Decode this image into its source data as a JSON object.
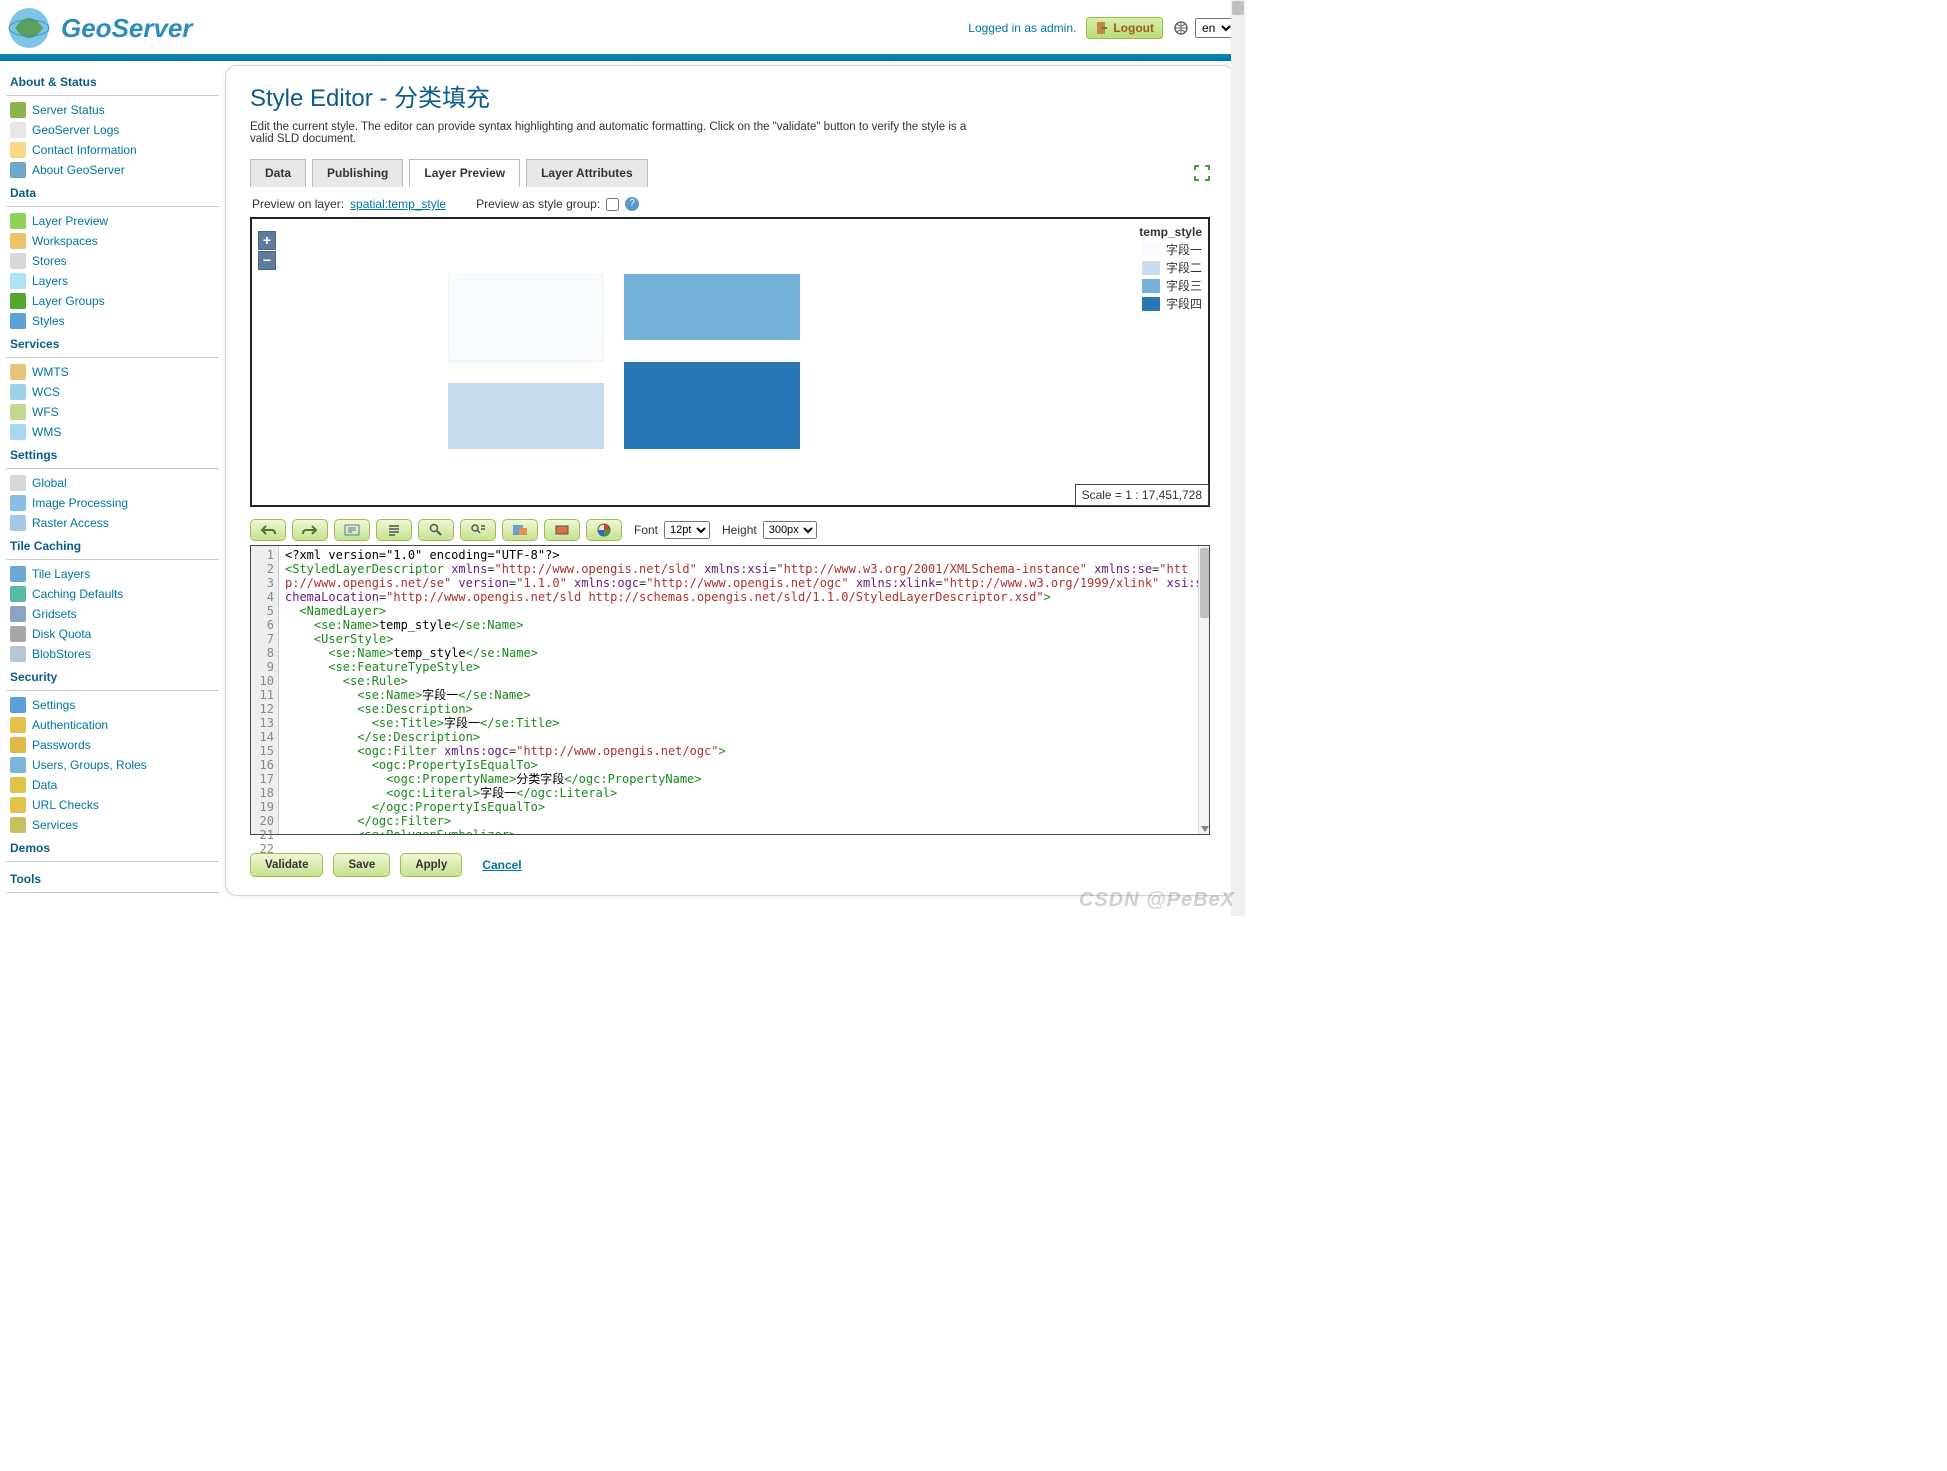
{
  "header": {
    "brand": "GeoServer",
    "loggedIn": "Logged in as admin.",
    "logoutLabel": "Logout",
    "langValue": "en"
  },
  "sidebar": {
    "sections": [
      {
        "title": "About & Status",
        "items": [
          {
            "label": "Server Status",
            "icon": "#8fb24a"
          },
          {
            "label": "GeoServer Logs",
            "icon": "#e6e6e6"
          },
          {
            "label": "Contact Information",
            "icon": "#f8d882"
          },
          {
            "label": "About GeoServer",
            "icon": "#6fa7c9"
          }
        ]
      },
      {
        "title": "Data",
        "items": [
          {
            "label": "Layer Preview",
            "icon": "#8ed25a"
          },
          {
            "label": "Workspaces",
            "icon": "#e9c46a"
          },
          {
            "label": "Stores",
            "icon": "#d8d8d8"
          },
          {
            "label": "Layers",
            "icon": "#aee2f7"
          },
          {
            "label": "Layer Groups",
            "icon": "#55a630"
          },
          {
            "label": "Styles",
            "icon": "#5da0d6"
          }
        ]
      },
      {
        "title": "Services",
        "items": [
          {
            "label": "WMTS",
            "icon": "#e6c27a"
          },
          {
            "label": "WCS",
            "icon": "#9ed0e6"
          },
          {
            "label": "WFS",
            "icon": "#c1d890"
          },
          {
            "label": "WMS",
            "icon": "#a8d8ef"
          }
        ]
      },
      {
        "title": "Settings",
        "items": [
          {
            "label": "Global",
            "icon": "#d8d8d8"
          },
          {
            "label": "Image Processing",
            "icon": "#88bde6"
          },
          {
            "label": "Raster Access",
            "icon": "#a5c8e4"
          }
        ]
      },
      {
        "title": "Tile Caching",
        "items": [
          {
            "label": "Tile Layers",
            "icon": "#6aa9d6"
          },
          {
            "label": "Caching Defaults",
            "icon": "#5bb8a8"
          },
          {
            "label": "Gridsets",
            "icon": "#8aa5c2"
          },
          {
            "label": "Disk Quota",
            "icon": "#a6a6a6"
          },
          {
            "label": "BlobStores",
            "icon": "#b8c6d6"
          }
        ]
      },
      {
        "title": "Security",
        "items": [
          {
            "label": "Settings",
            "icon": "#5aa0d6"
          },
          {
            "label": "Authentication",
            "icon": "#e0c24a"
          },
          {
            "label": "Passwords",
            "icon": "#e0b84a"
          },
          {
            "label": "Users, Groups, Roles",
            "icon": "#7db4d9"
          },
          {
            "label": "Data",
            "icon": "#e0c24a"
          },
          {
            "label": "URL Checks",
            "icon": "#e0c24a"
          },
          {
            "label": "Services",
            "icon": "#c8c060"
          }
        ]
      },
      {
        "title": "Demos",
        "items": []
      },
      {
        "title": "Tools",
        "items": []
      }
    ]
  },
  "page": {
    "title": "Style Editor - 分类填充",
    "description": "Edit the current style. The editor can provide syntax highlighting and automatic formatting. Click on the \"validate\" button to verify the style is a valid SLD document."
  },
  "tabs": [
    "Data",
    "Publishing",
    "Layer Preview",
    "Layer Attributes"
  ],
  "activeTab": "Layer Preview",
  "preview": {
    "label": "Preview on layer:",
    "layer": "spatial:temp_style",
    "styleGroupLabel": "Preview as style group:"
  },
  "map": {
    "legendTitle": "temp_style",
    "legend": [
      {
        "label": "字段一",
        "color": "#f7fbff"
      },
      {
        "label": "字段二",
        "color": "#c7dcef"
      },
      {
        "label": "字段三",
        "color": "#72b2d7"
      },
      {
        "label": "字段四",
        "color": "#2878b8"
      }
    ],
    "scale": "Scale = 1 : 17,451,728"
  },
  "toolbar": {
    "fontLabel": "Font",
    "fontValue": "12pt",
    "heightLabel": "Height",
    "heightValue": "300px"
  },
  "editor": {
    "lines": 22
  },
  "actions": {
    "validate": "Validate",
    "save": "Save",
    "apply": "Apply",
    "cancel": "Cancel"
  },
  "watermark": "CSDN @PeBeX"
}
